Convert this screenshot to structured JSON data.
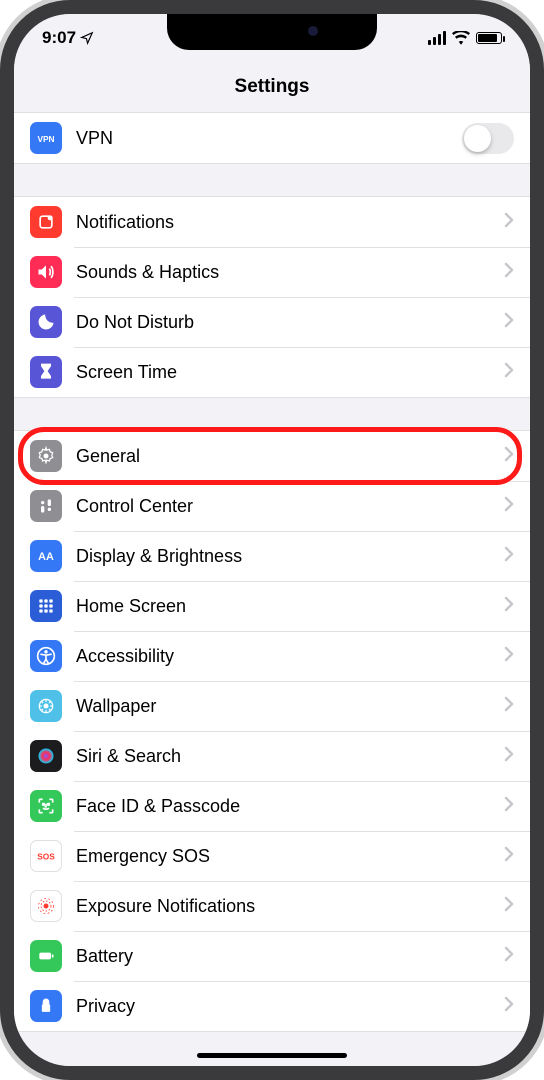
{
  "status": {
    "time": "9:07"
  },
  "header": {
    "title": "Settings"
  },
  "groups": [
    {
      "rows": [
        {
          "key": "vpn",
          "label": "VPN",
          "icon": "vpn",
          "color": "#3478f6",
          "control": "toggle"
        }
      ]
    },
    {
      "rows": [
        {
          "key": "notifications",
          "label": "Notifications",
          "icon": "notifications",
          "color": "#ff3b30",
          "control": "chevron"
        },
        {
          "key": "sounds",
          "label": "Sounds & Haptics",
          "icon": "sounds",
          "color": "#ff2d55",
          "control": "chevron"
        },
        {
          "key": "dnd",
          "label": "Do Not Disturb",
          "icon": "dnd",
          "color": "#5856d6",
          "control": "chevron"
        },
        {
          "key": "screentime",
          "label": "Screen Time",
          "icon": "screentime",
          "color": "#5856d6",
          "control": "chevron"
        }
      ]
    },
    {
      "rows": [
        {
          "key": "general",
          "label": "General",
          "icon": "general",
          "color": "#8e8e93",
          "control": "chevron",
          "highlight": true
        },
        {
          "key": "controlcenter",
          "label": "Control Center",
          "icon": "controlcenter",
          "color": "#8e8e93",
          "control": "chevron"
        },
        {
          "key": "display",
          "label": "Display & Brightness",
          "icon": "display",
          "color": "#3478f6",
          "control": "chevron"
        },
        {
          "key": "homescreen",
          "label": "Home Screen",
          "icon": "homescreen",
          "color": "#2b5ed6",
          "control": "chevron"
        },
        {
          "key": "accessibility",
          "label": "Accessibility",
          "icon": "accessibility",
          "color": "#3478f6",
          "control": "chevron"
        },
        {
          "key": "wallpaper",
          "label": "Wallpaper",
          "icon": "wallpaper",
          "color": "#4fc1e9",
          "control": "chevron"
        },
        {
          "key": "siri",
          "label": "Siri & Search",
          "icon": "siri",
          "color": "#1c1c1e",
          "control": "chevron"
        },
        {
          "key": "faceid",
          "label": "Face ID & Passcode",
          "icon": "faceid",
          "color": "#34c759",
          "control": "chevron"
        },
        {
          "key": "sos",
          "label": "Emergency SOS",
          "icon": "sos",
          "color": "#ffffff",
          "textcolor": "#ff3b30",
          "text": "SOS",
          "control": "chevron"
        },
        {
          "key": "exposure",
          "label": "Exposure Notifications",
          "icon": "exposure",
          "color": "#ffffff",
          "textcolor": "#ff3b30",
          "control": "chevron"
        },
        {
          "key": "battery",
          "label": "Battery",
          "icon": "battery",
          "color": "#34c759",
          "control": "chevron"
        },
        {
          "key": "privacy",
          "label": "Privacy",
          "icon": "privacy",
          "color": "#3478f6",
          "control": "chevron"
        }
      ]
    }
  ]
}
